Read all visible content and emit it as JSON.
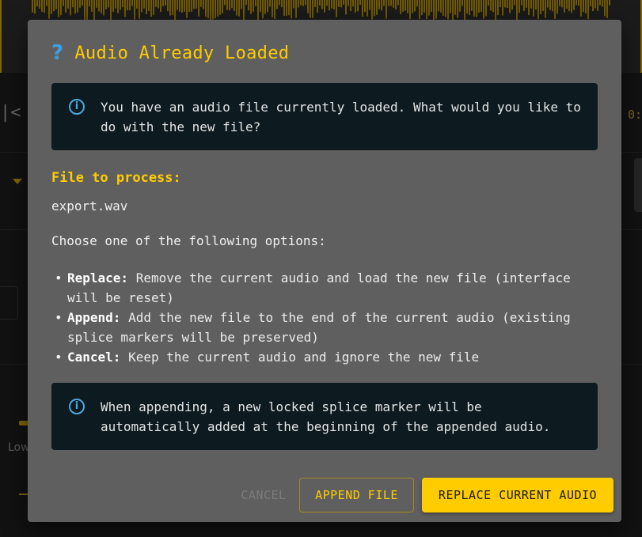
{
  "background": {
    "time_readout": "0:",
    "low_label": "Low"
  },
  "dialog": {
    "title": "Audio Already Loaded",
    "title_icon": "question-icon",
    "notice": "You have an audio file currently loaded. What would you like to do with the new file?",
    "file_label": "File to process:",
    "file_name": "export.wav",
    "choose_text": "Choose one of the following options:",
    "options": [
      {
        "name": "Replace:",
        "desc": " Remove the current audio and load the new file (interface will be reset)"
      },
      {
        "name": "Append:",
        "desc": " Add the new file to the end of the current audio (existing splice markers will be preserved)"
      },
      {
        "name": "Cancel:",
        "desc": " Keep the current audio and ignore the new file"
      }
    ],
    "append_note": "When appending, a new locked splice marker will be automatically added at the beginning of the appended audio.",
    "buttons": {
      "cancel": "CANCEL",
      "append": "APPEND FILE",
      "replace": "REPLACE CURRENT AUDIO"
    }
  },
  "colors": {
    "accent": "#ffcc00",
    "info_blue": "#4aa8e0",
    "dialog_bg": "#5f5f5f",
    "info_bg": "#0d1a20"
  }
}
